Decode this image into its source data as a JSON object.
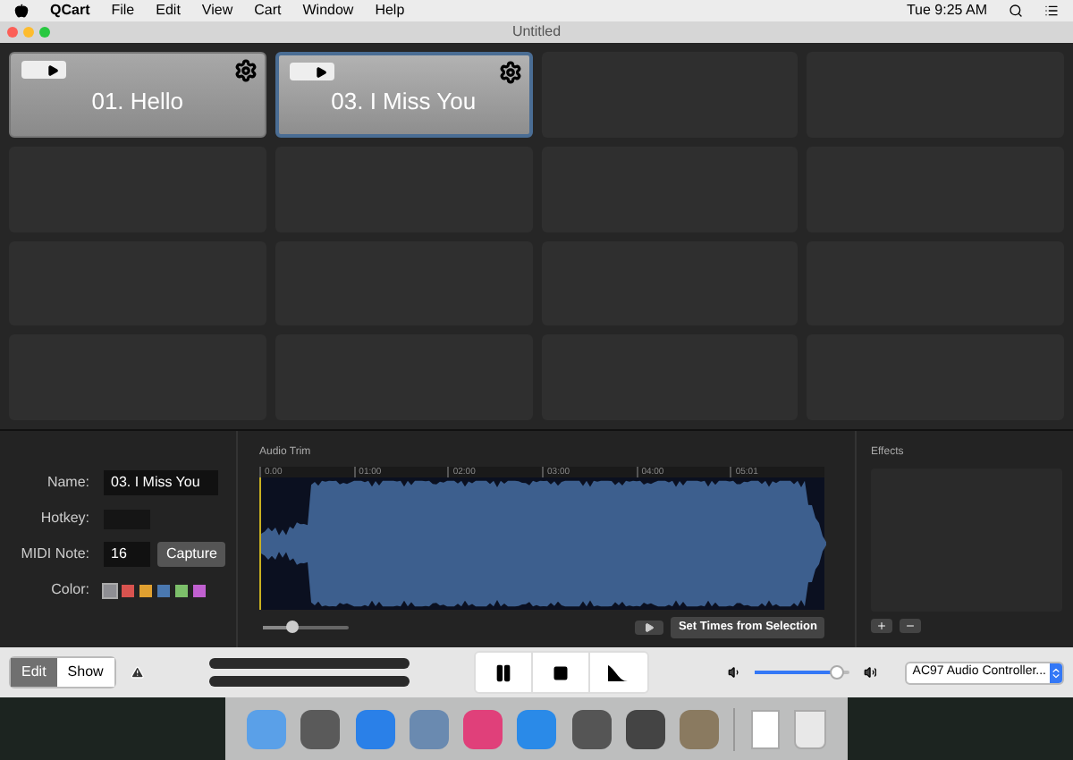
{
  "menu_bar": {
    "app": "QCart",
    "items": [
      "File",
      "Edit",
      "View",
      "Cart",
      "Window",
      "Help"
    ],
    "clock": "Tue 9:25 AM"
  },
  "window": {
    "title": "Untitled"
  },
  "carts": [
    {
      "label": "01. Hello",
      "selected": false
    },
    {
      "label": "03. I Miss You",
      "selected": true
    },
    {
      "selected": false
    },
    {
      "selected": false
    },
    {
      "selected": false
    },
    {
      "selected": false
    },
    {
      "selected": false
    },
    {
      "selected": false
    },
    {
      "selected": false
    },
    {
      "selected": false
    },
    {
      "selected": false
    },
    {
      "selected": false
    },
    {
      "selected": false
    },
    {
      "selected": false
    },
    {
      "selected": false
    },
    {
      "selected": false
    }
  ],
  "inspector": {
    "name_label": "Name:",
    "name_value": "03. I Miss You",
    "hotkey_label": "Hotkey:",
    "midi_label": "MIDI Note:",
    "midi_value": "16",
    "capture_button": "Capture",
    "color_label": "Color:",
    "colors": [
      {
        "color": "#8e8e93",
        "selected": true
      },
      {
        "color": "#d9534f",
        "selected": false
      },
      {
        "color": "#e0a030",
        "selected": false
      },
      {
        "color": "#4a78b0",
        "selected": false
      },
      {
        "color": "#7cbf6a",
        "selected": false
      },
      {
        "color": "#c060d0",
        "selected": false
      }
    ]
  },
  "audio_trim": {
    "title": "Audio Trim",
    "ticks": [
      "0.00",
      "01:00",
      "02:00",
      "03:00",
      "04:00",
      "05:01"
    ],
    "zoom": {
      "level": 0.33
    },
    "set_times_button": "Set Times from Selection"
  },
  "effects": {
    "title": "Effects"
  },
  "toolbar": {
    "modes": [
      {
        "label": "Edit",
        "selected": true
      },
      {
        "label": "Show",
        "selected": false
      }
    ],
    "volume": {
      "level": 0.88
    },
    "output_device": "AC97 Audio Controller..."
  }
}
